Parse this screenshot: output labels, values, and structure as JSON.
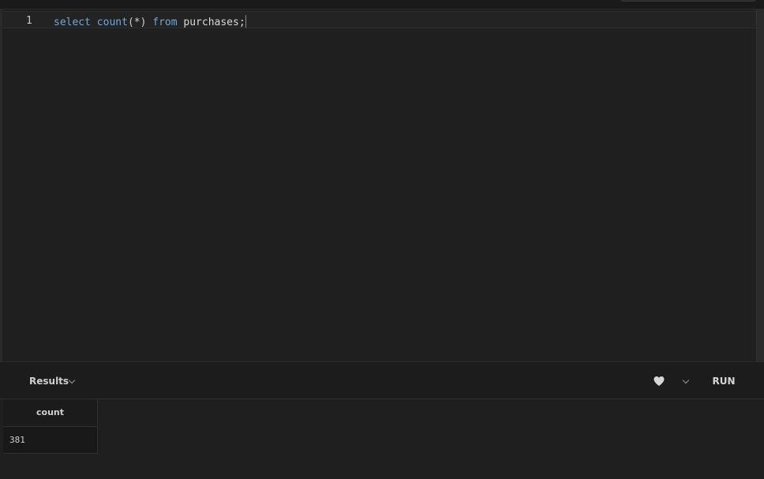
{
  "editor": {
    "line_number": "1",
    "tokens": {
      "select": "select",
      "count": "count",
      "open_paren": "(",
      "star": "*",
      "close_paren": ")",
      "from": "from",
      "table": "purchases",
      "semicolon": ";"
    }
  },
  "results": {
    "label": "Results",
    "run_label": "RUN",
    "columns": [
      "count"
    ],
    "rows": [
      [
        "381"
      ]
    ]
  },
  "icons": {
    "results_dropdown": "chevron-down-icon",
    "favorite": "heart-icon",
    "favorite_dropdown": "chevron-down-icon"
  },
  "colors": {
    "background": "#1f1f1f",
    "keyword": "#6fa8dc"
  }
}
